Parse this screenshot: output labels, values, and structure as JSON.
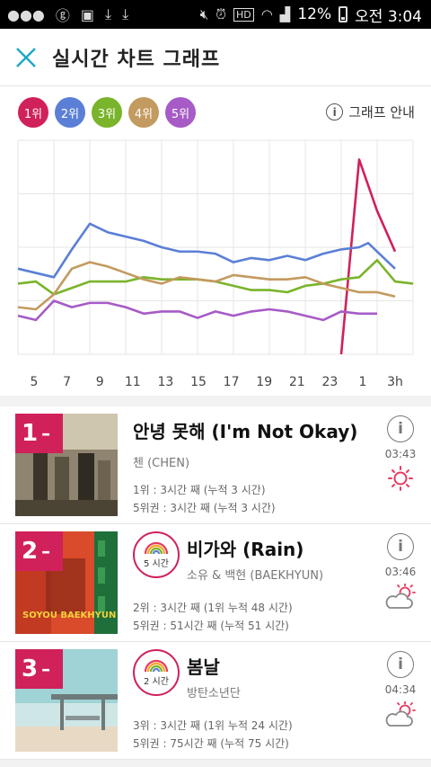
{
  "status_bar": {
    "battery": "12%",
    "time": "오전 3:04"
  },
  "header": {
    "title": "실시간 차트 그래프"
  },
  "graph": {
    "guide_label": "그래프 안내",
    "legend": [
      {
        "label": "1위",
        "color": "#d0215a"
      },
      {
        "label": "2위",
        "color": "#5b7fd6"
      },
      {
        "label": "3위",
        "color": "#79b42a"
      },
      {
        "label": "4위",
        "color": "#c39a5f"
      },
      {
        "label": "5위",
        "color": "#a65bc6"
      }
    ]
  },
  "chart_data": {
    "type": "line",
    "x_tick_labels": [
      "5",
      "7",
      "9",
      "11",
      "13",
      "15",
      "17",
      "19",
      "21",
      "23",
      "1",
      "3h"
    ],
    "series": [
      {
        "name": "1위",
        "color": "#d0215a",
        "points": [
          [
            22,
            100
          ],
          [
            23,
            9
          ],
          [
            24,
            33
          ],
          [
            25,
            52
          ]
        ]
      },
      {
        "name": "2위",
        "color": "#5b7fd6",
        "points": [
          [
            4,
            60
          ],
          [
            5,
            62
          ],
          [
            6,
            64
          ],
          [
            7,
            51
          ],
          [
            8,
            39
          ],
          [
            9,
            43
          ],
          [
            10,
            45
          ],
          [
            11,
            47
          ],
          [
            12,
            50
          ],
          [
            13,
            52
          ],
          [
            14,
            52
          ],
          [
            15,
            53
          ],
          [
            16,
            57
          ],
          [
            17,
            55
          ],
          [
            18,
            56
          ],
          [
            19,
            54
          ],
          [
            20,
            56
          ],
          [
            21,
            53
          ],
          [
            22,
            51
          ],
          [
            23,
            50
          ],
          [
            23.5,
            48
          ],
          [
            24,
            52
          ],
          [
            25,
            60
          ]
        ]
      },
      {
        "name": "3위",
        "color": "#79b42a",
        "points": [
          [
            4,
            67
          ],
          [
            5,
            66
          ],
          [
            6,
            72
          ],
          [
            7,
            69
          ],
          [
            8,
            66
          ],
          [
            9,
            66
          ],
          [
            10,
            66
          ],
          [
            11,
            64
          ],
          [
            12,
            65
          ],
          [
            13,
            65
          ],
          [
            14,
            65
          ],
          [
            15,
            66
          ],
          [
            16,
            68
          ],
          [
            17,
            70
          ],
          [
            18,
            70
          ],
          [
            19,
            71
          ],
          [
            20,
            68
          ],
          [
            21,
            67
          ],
          [
            22,
            65
          ],
          [
            23,
            64
          ],
          [
            24,
            56
          ],
          [
            25,
            66
          ],
          [
            26,
            67
          ]
        ]
      },
      {
        "name": "4위",
        "color": "#c39a5f",
        "points": [
          [
            4,
            78
          ],
          [
            5,
            79
          ],
          [
            6,
            72
          ],
          [
            7,
            60
          ],
          [
            8,
            57
          ],
          [
            9,
            59
          ],
          [
            10,
            62
          ],
          [
            11,
            65
          ],
          [
            12,
            67
          ],
          [
            13,
            64
          ],
          [
            14,
            65
          ],
          [
            15,
            66
          ],
          [
            16,
            63
          ],
          [
            17,
            64
          ],
          [
            18,
            65
          ],
          [
            19,
            65
          ],
          [
            20,
            64
          ],
          [
            21,
            67
          ],
          [
            22,
            69
          ],
          [
            23,
            71
          ],
          [
            24,
            71
          ],
          [
            25,
            73
          ]
        ]
      },
      {
        "name": "5위",
        "color": "#a65bc6",
        "points": [
          [
            4,
            82
          ],
          [
            5,
            84
          ],
          [
            6,
            75
          ],
          [
            7,
            78
          ],
          [
            8,
            76
          ],
          [
            9,
            76
          ],
          [
            10,
            78
          ],
          [
            11,
            81
          ],
          [
            12,
            80
          ],
          [
            13,
            80
          ],
          [
            14,
            83
          ],
          [
            15,
            80
          ],
          [
            16,
            82
          ],
          [
            17,
            80
          ],
          [
            18,
            79
          ],
          [
            19,
            80
          ],
          [
            20,
            82
          ],
          [
            21,
            84
          ],
          [
            22,
            80
          ],
          [
            23,
            81
          ],
          [
            24,
            81
          ]
        ]
      }
    ],
    "y_range": [
      0,
      100
    ],
    "y_inverted": true
  },
  "items": [
    {
      "rank": "1",
      "title": "안녕 못해 (I'm Not Okay)",
      "artist": "첸 (CHEN)",
      "stat1": "1위 : 3시간 째 (누적 3 시간)",
      "stat2": "5위권 : 3시간 째 (누적 3 시간)",
      "time": "03:43",
      "weather": "sun-icon"
    },
    {
      "rank": "2",
      "title": "비가와 (Rain)",
      "artist": "소유 & 백현 (BAEKHYUN)",
      "badge": "5 시간",
      "stat1": "2위 : 3시간 째 (1위 누적 48 시간)",
      "stat2": "5위권 : 51시간 째 (누적 51 시간)",
      "time": "03:46",
      "weather": "cloud-sun-icon",
      "cover_text": "SOYOU BAEKHYUN"
    },
    {
      "rank": "3",
      "title": "봄날",
      "artist": "방탄소년단",
      "badge": "2 시간",
      "stat1": "3위 : 3시간 째 (1위 누적 24 시간)",
      "stat2": "5위권 : 75시간 째 (누적 75 시간)",
      "time": "04:34",
      "weather": "cloud-sun-icon"
    }
  ]
}
